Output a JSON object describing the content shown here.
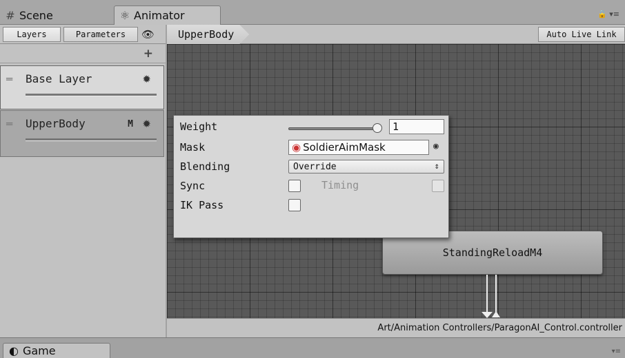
{
  "tabs": {
    "scene": {
      "label": "Scene",
      "icon": "grid-hash-icon"
    },
    "animator": {
      "label": "Animator",
      "icon": "animator-icon"
    },
    "game": {
      "label": "Game",
      "icon": "game-icon"
    }
  },
  "toolbar": {
    "layers_label": "Layers",
    "parameters_label": "Parameters",
    "add_symbol": "+",
    "auto_live_link_label": "Auto Live Link"
  },
  "breadcrumb": "UpperBody",
  "layers": [
    {
      "name": "Base Layer",
      "badge": "",
      "selected": false
    },
    {
      "name": "UpperBody",
      "badge": "M",
      "selected": true
    }
  ],
  "layer_settings": {
    "weight_label": "Weight",
    "weight_value": "1",
    "weight_fraction": 1,
    "mask_label": "Mask",
    "mask_value": "SoldierAimMask",
    "blending_label": "Blending",
    "blending_value": "Override",
    "sync_label": "Sync",
    "timing_label": "Timing",
    "ik_pass_label": "IK Pass",
    "sync_checked": false,
    "timing_checked": false,
    "ik_pass_checked": false
  },
  "state_node": {
    "label": "StandingReloadM4"
  },
  "path": "Art/Animation Controllers/ParagonAI_Control.controller"
}
